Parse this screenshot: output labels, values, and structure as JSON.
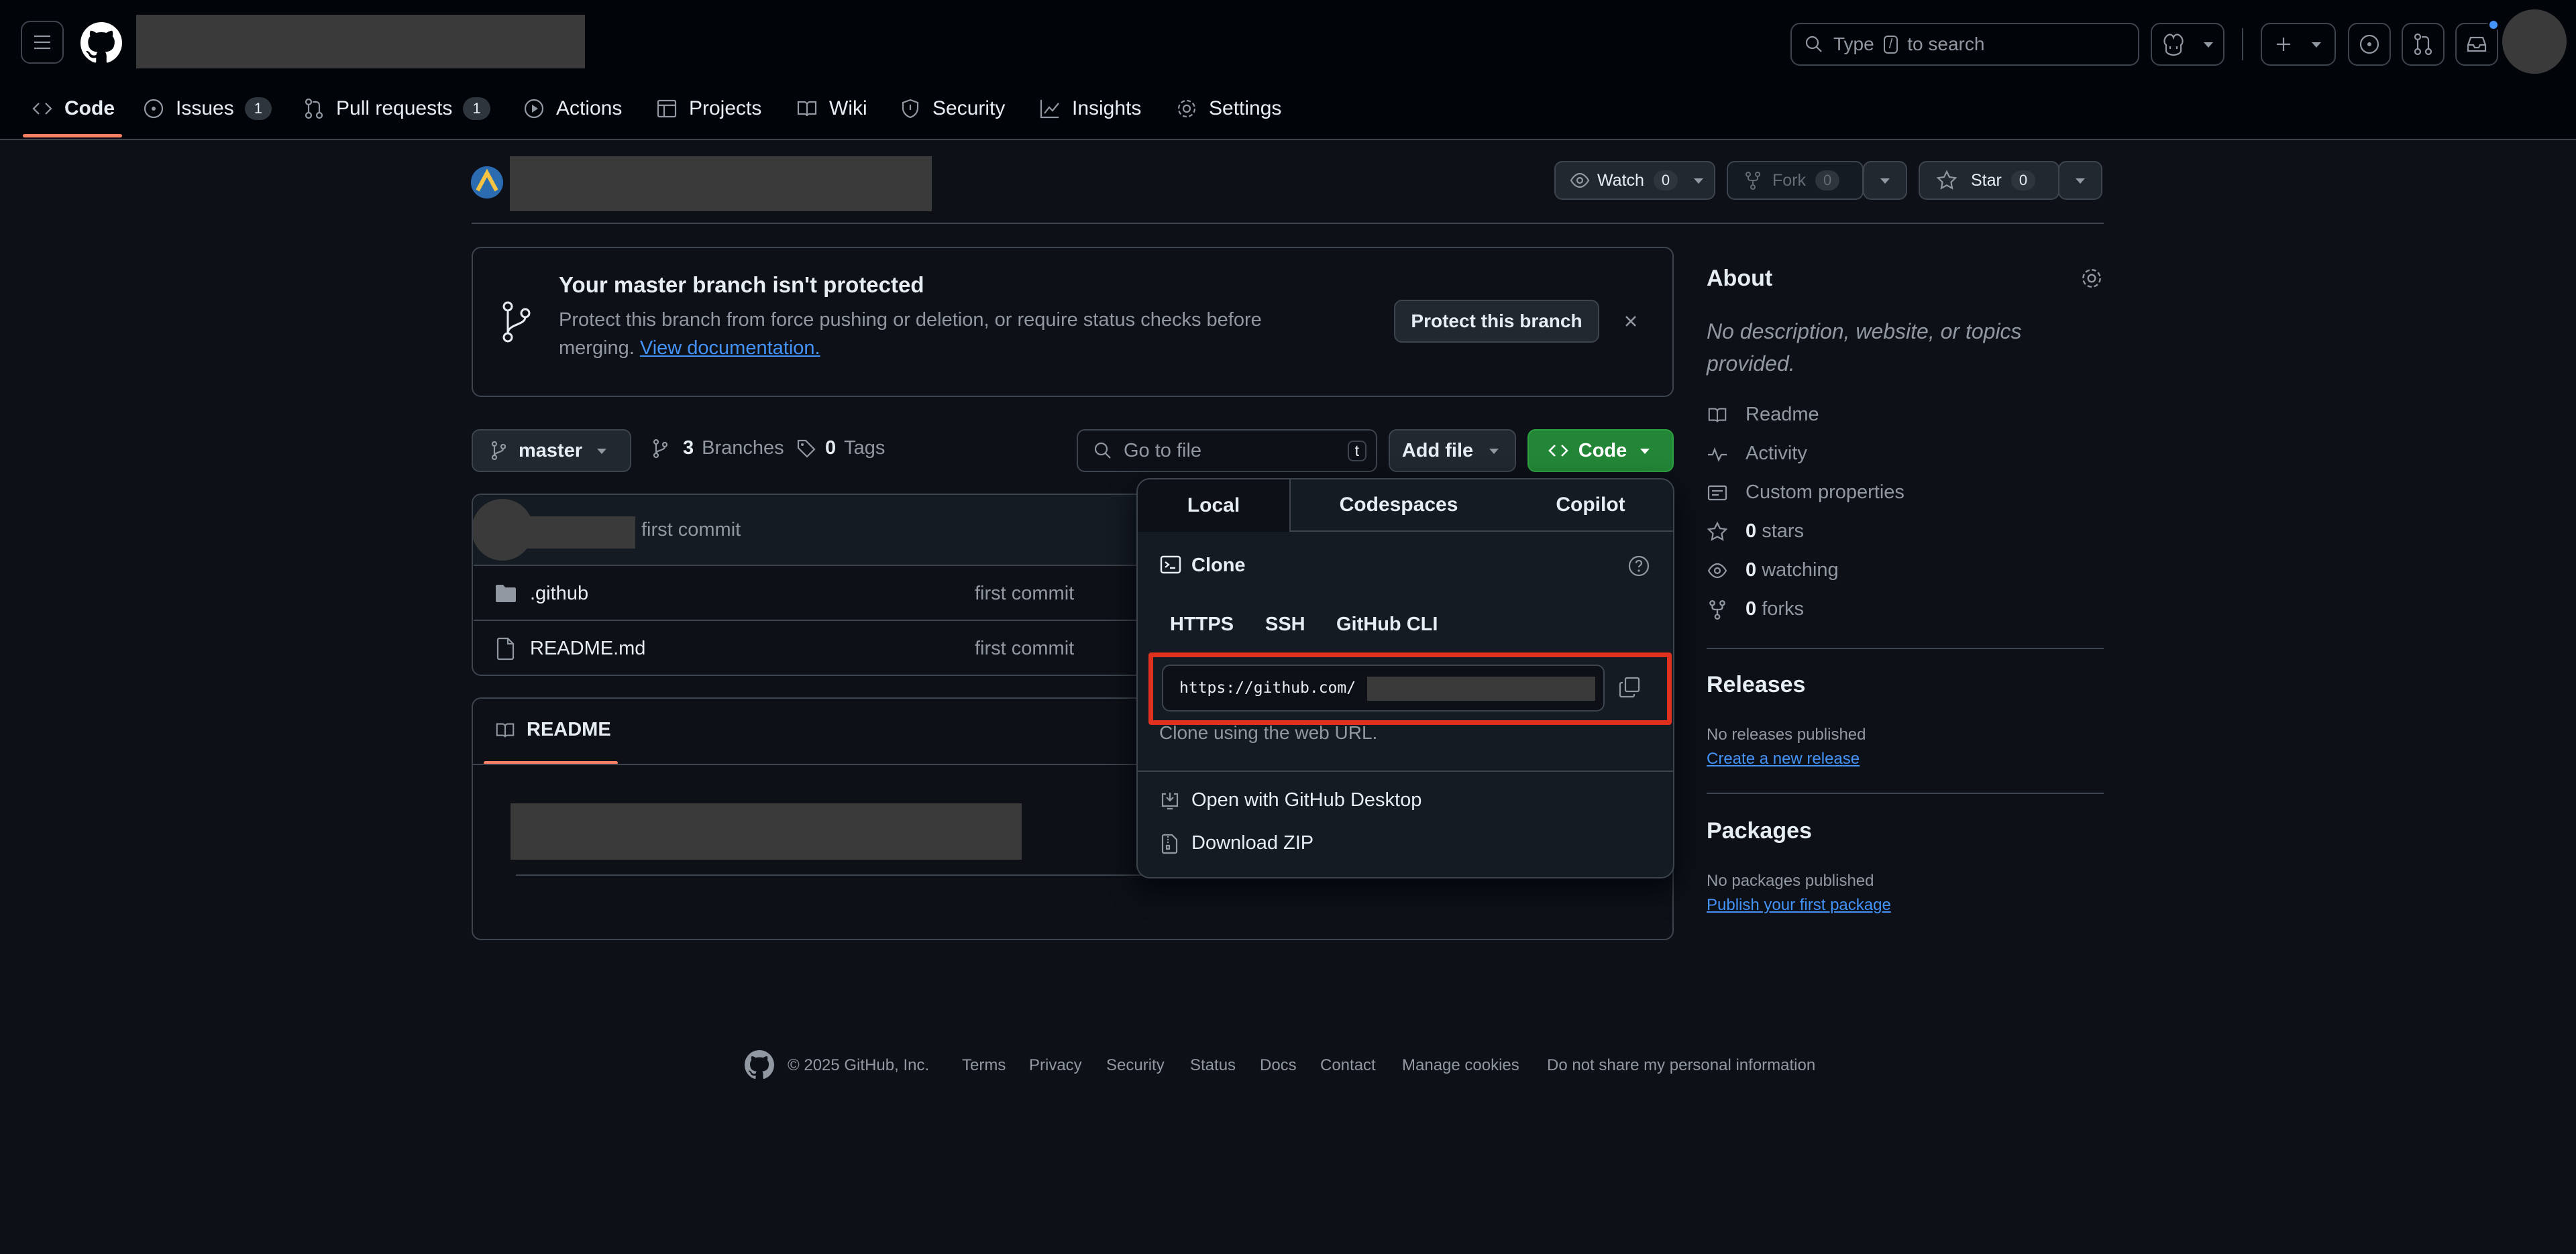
{
  "header": {
    "search_placeholder": "Type / to search",
    "search_pre": "Type",
    "search_key": "/",
    "search_post": "to search"
  },
  "nav": {
    "tabs": [
      {
        "label": "Code"
      },
      {
        "label": "Issues",
        "count": "1"
      },
      {
        "label": "Pull requests",
        "count": "1"
      },
      {
        "label": "Actions"
      },
      {
        "label": "Projects"
      },
      {
        "label": "Wiki"
      },
      {
        "label": "Security"
      },
      {
        "label": "Insights"
      },
      {
        "label": "Settings"
      }
    ]
  },
  "repo": {
    "watch_label": "Watch",
    "watch_count": "0",
    "fork_label": "Fork",
    "fork_count": "0",
    "star_label": "Star",
    "star_count": "0"
  },
  "banner": {
    "title": "Your master branch isn't protected",
    "text": "Protect this branch from force pushing or deletion, or require status checks before merging.",
    "link": "View documentation.",
    "button": "Protect this branch"
  },
  "toolbar": {
    "branch": "master",
    "branches_count": "3",
    "branches_label": "Branches",
    "tags_count": "0",
    "tags_label": "Tags",
    "goto_placeholder": "Go to file",
    "goto_key": "t",
    "add_file": "Add file",
    "code": "Code"
  },
  "files": {
    "latest_commit": "first commit",
    "rows": [
      {
        "name": ".github",
        "commit": "first commit",
        "type": "folder"
      },
      {
        "name": "README.md",
        "commit": "first commit",
        "type": "file"
      }
    ]
  },
  "readme": {
    "tab": "README"
  },
  "clone": {
    "tabs": [
      "Local",
      "Codespaces",
      "Copilot"
    ],
    "title": "Clone",
    "protocols": [
      "HTTPS",
      "SSH",
      "GitHub CLI"
    ],
    "url": "https://github.com/",
    "hint": "Clone using the web URL.",
    "desktop": "Open with GitHub Desktop",
    "zip": "Download ZIP"
  },
  "about": {
    "title": "About",
    "description": "No description, website, or topics provided.",
    "items": [
      {
        "label": "Readme",
        "icon": "book-icon"
      },
      {
        "label": "Activity",
        "icon": "pulse-icon"
      },
      {
        "label": "Custom properties",
        "icon": "note-icon"
      },
      {
        "count": "0",
        "label": "stars",
        "icon": "star-icon"
      },
      {
        "count": "0",
        "label": "watching",
        "icon": "eye-icon"
      },
      {
        "count": "0",
        "label": "forks",
        "icon": "fork-icon"
      }
    ]
  },
  "releases": {
    "title": "Releases",
    "none": "No releases published",
    "link": "Create a new release"
  },
  "packages": {
    "title": "Packages",
    "none": "No packages published",
    "link": "Publish your first package"
  },
  "footer": {
    "copyright": "© 2025 GitHub, Inc.",
    "links": [
      "Terms",
      "Privacy",
      "Security",
      "Status",
      "Docs",
      "Contact",
      "Manage cookies",
      "Do not share my personal information"
    ]
  },
  "colors": {
    "accent_green": "#238636",
    "highlight_red": "#e0301e",
    "link_blue": "#4493f8",
    "nav_underline": "#f78166"
  }
}
